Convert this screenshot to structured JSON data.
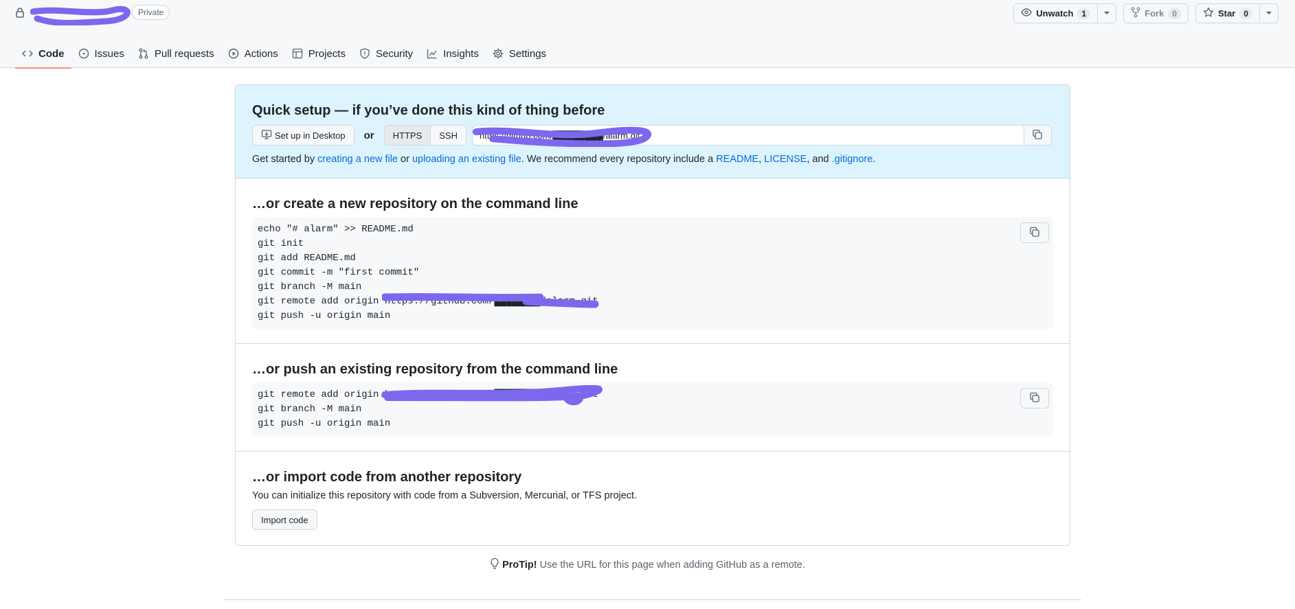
{
  "repo": {
    "name": "alarm",
    "visibility": "Private"
  },
  "repo_actions": {
    "unwatch_label": "Unwatch",
    "unwatch_count": "1",
    "fork_label": "Fork",
    "fork_count": "0",
    "star_label": "Star",
    "star_count": "0"
  },
  "tabs": [
    {
      "label": "Code",
      "icon": "code-icon",
      "active": true
    },
    {
      "label": "Issues",
      "icon": "issue-opened-icon"
    },
    {
      "label": "Pull requests",
      "icon": "git-pull-request-icon"
    },
    {
      "label": "Actions",
      "icon": "play-icon"
    },
    {
      "label": "Projects",
      "icon": "table-icon"
    },
    {
      "label": "Security",
      "icon": "shield-icon"
    },
    {
      "label": "Insights",
      "icon": "graph-icon"
    },
    {
      "label": "Settings",
      "icon": "gear-icon"
    }
  ],
  "quick_setup": {
    "title": "Quick setup — if you’ve done this kind of thing before",
    "desktop_button": "Set up in Desktop",
    "or": "or",
    "https": "HTTPS",
    "ssh": "SSH",
    "url_value": "https://github.com/████████/alarm.git",
    "get_started_prefix": "Get started by",
    "link_new_file": "creating a new file",
    "or_word": "or",
    "link_upload": "uploading an existing file",
    "recommend": ". We recommend every repository include a",
    "link_readme": "README",
    "comma": ",",
    "link_license": "LICENSE",
    "and_word": ", and",
    "link_gitignore": ".gitignore",
    "period": "."
  },
  "new_repo": {
    "title": "…or create a new repository on the command line",
    "lines": [
      "echo \"# alarm\" >> README.md",
      "git init",
      "git add README.md",
      "git commit -m \"first commit\"",
      "git branch -M main",
      "git remote add origin ",
      "git push -u origin main"
    ],
    "remote_url": "https://github.com/████████/alarm.git"
  },
  "push_existing": {
    "title": "…or push an existing repository from the command line",
    "lines": [
      "git remote add origin ",
      "git branch -M main",
      "git push -u origin main"
    ],
    "remote_url": "https://github.com/████████/alarm.git"
  },
  "import": {
    "title": "…or import code from another repository",
    "text": "You can initialize this repository with code from a Subversion, Mercurial, or TFS project.",
    "button": "Import code"
  },
  "protip": {
    "label": "ProTip!",
    "text": "Use the URL for this page when adding GitHub as a remote."
  },
  "colors": {
    "accent_link": "#0969da",
    "quick_setup_bg": "#ddf4ff",
    "active_tab_underline": "#fd8c73",
    "redaction": "#7b68ee"
  }
}
